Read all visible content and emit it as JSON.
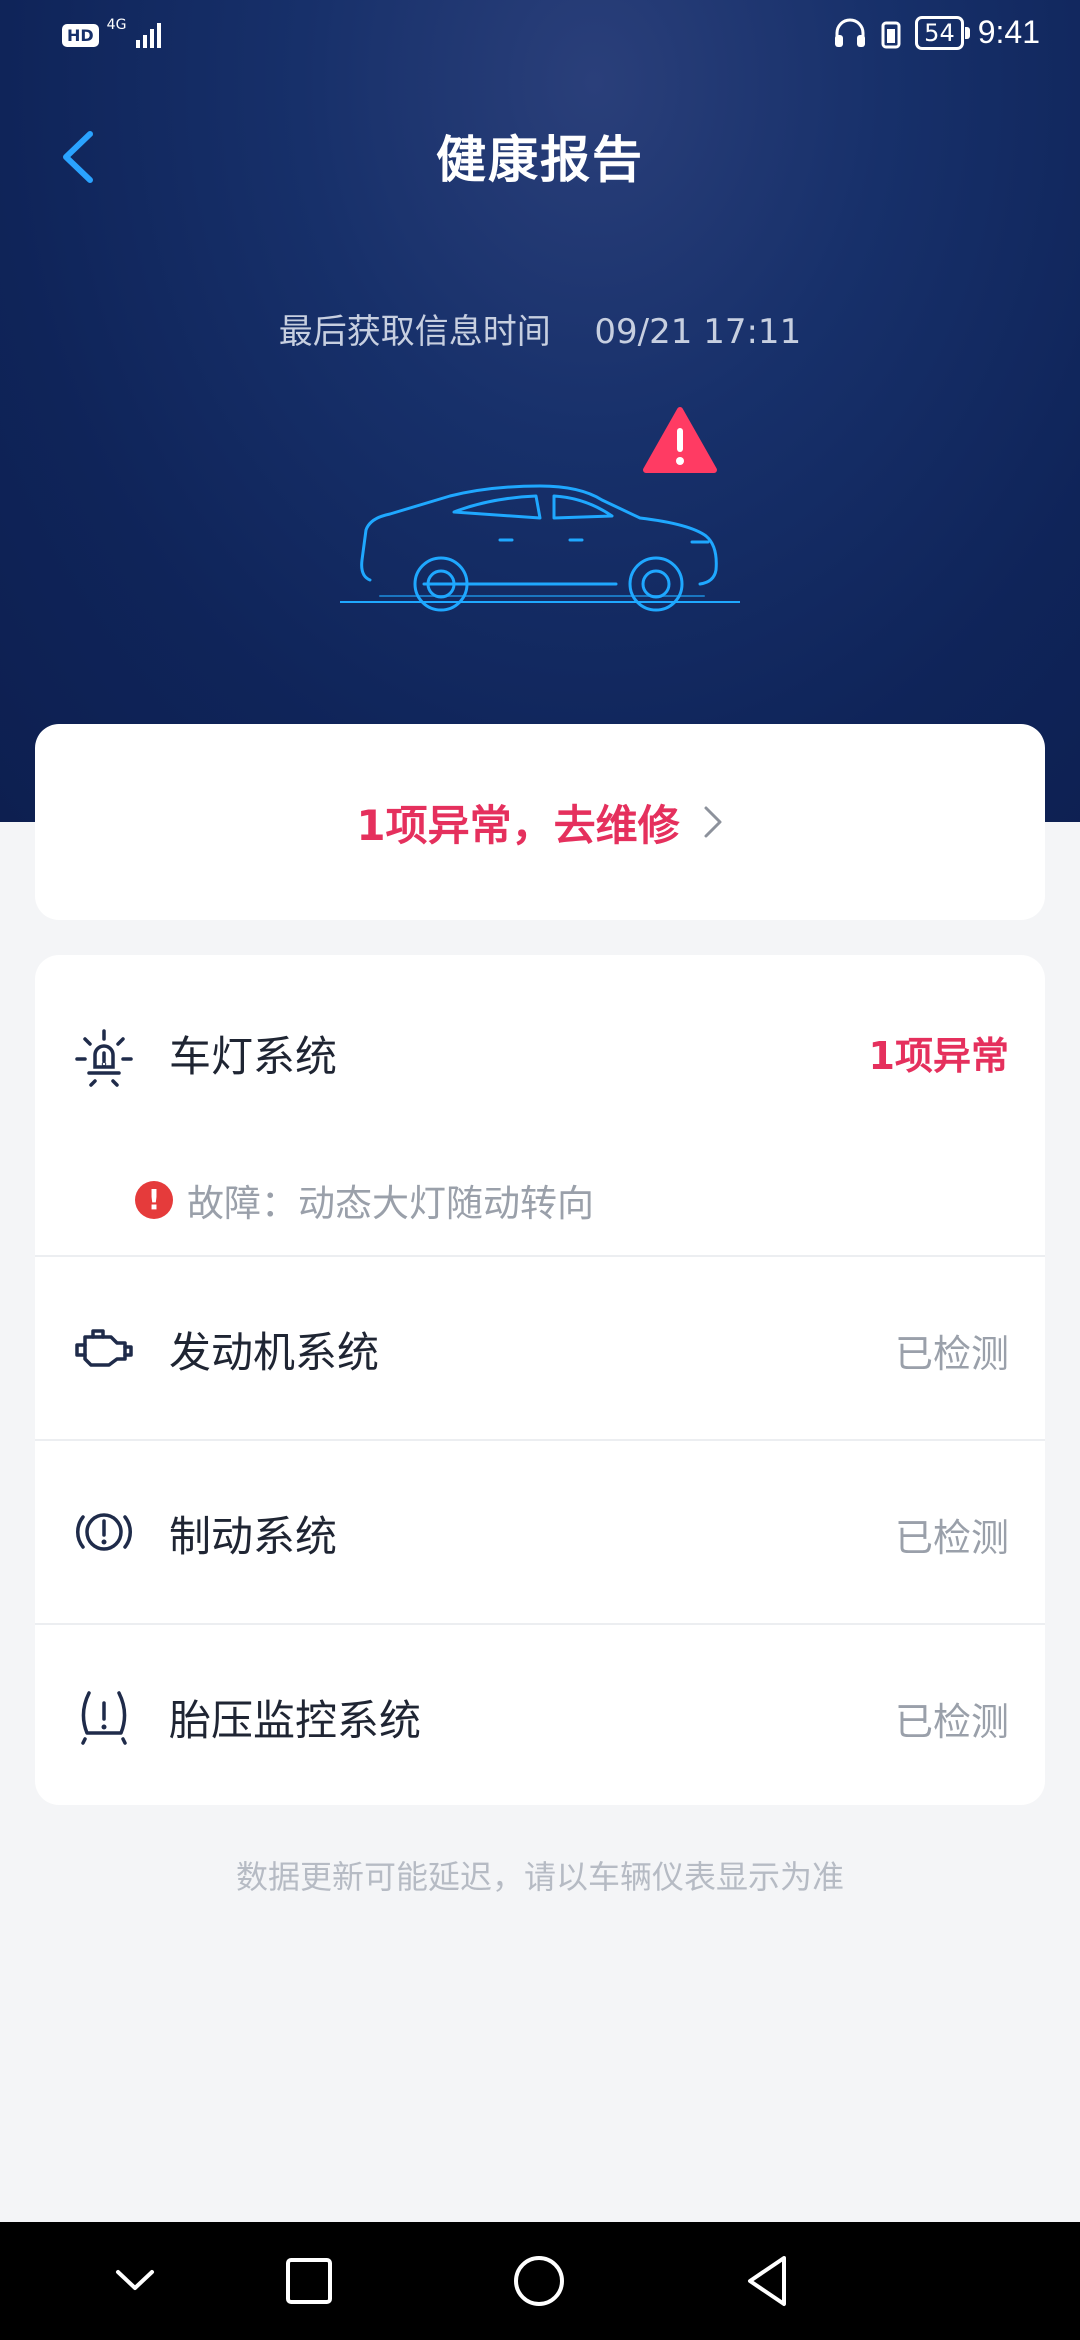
{
  "status_bar": {
    "hd": "HD",
    "network": "4G",
    "battery": "54",
    "time": "9:41"
  },
  "header": {
    "title": "健康报告",
    "last_update_label": "最后获取信息时间",
    "last_update_time": "09/21 17:11"
  },
  "alert": {
    "text": "1项异常，去维修",
    "color": "#e5305d"
  },
  "systems": [
    {
      "icon": "light-icon",
      "label": "车灯系统",
      "status": "1项异常",
      "fault": "故障：动态大灯随动转向"
    },
    {
      "icon": "engine-icon",
      "label": "发动机系统",
      "status": "已检测"
    },
    {
      "icon": "brake-icon",
      "label": "制动系统",
      "status": "已检测"
    },
    {
      "icon": "tire-pressure-icon",
      "label": "胎压监控系统",
      "status": "已检测"
    }
  ],
  "footnote": "数据更新可能延迟，请以车辆仪表显示为准",
  "nav": {
    "icons": [
      "nav-down-icon",
      "recent-apps-icon",
      "home-icon",
      "back-icon"
    ]
  }
}
